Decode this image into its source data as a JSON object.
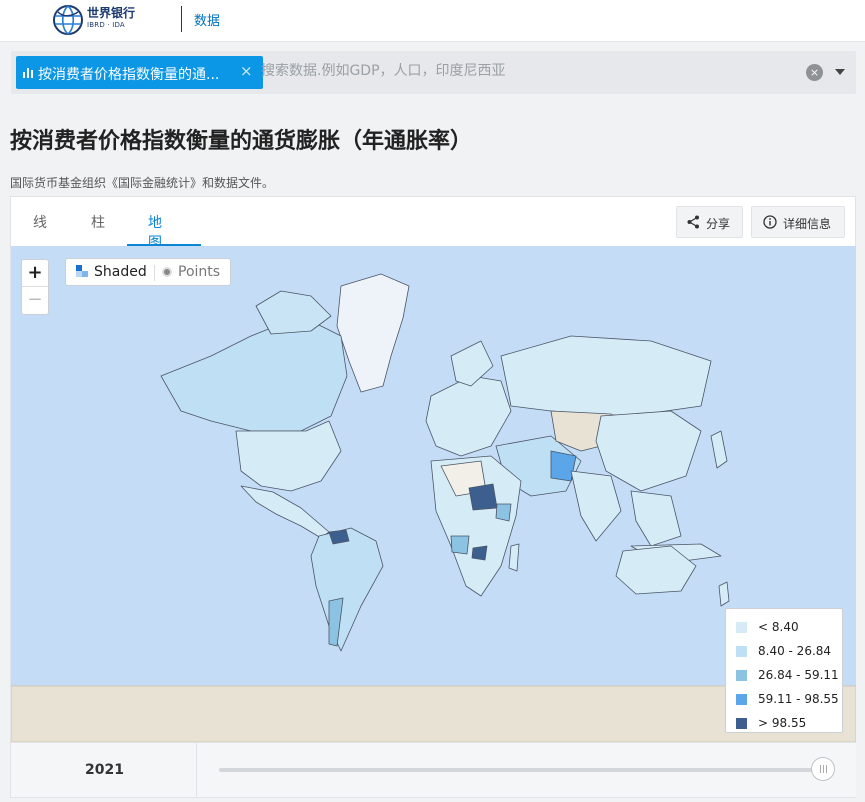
{
  "header": {
    "logo_title": "世界银行",
    "logo_subtitle": "IBRD · IDA",
    "nav_data": "数据"
  },
  "search": {
    "tag_label": "按消费者价格指数衡量的通...",
    "tag_close": "×",
    "placeholder": "搜索数据.例如GDP，人口，印度尼西亚",
    "clear": "×"
  },
  "page": {
    "title": "按消费者价格指数衡量的通货膨胀（年通胀率）",
    "source": "国际货币基金组织《国际金融统计》和数据文件。"
  },
  "tabs": [
    "线",
    "柱",
    "地图"
  ],
  "active_tab": "地图",
  "actions": {
    "share": "分享",
    "details": "详细信息"
  },
  "map": {
    "zoom_in": "+",
    "zoom_out": "−",
    "mode_shaded": "Shaded",
    "mode_points": "Points",
    "active_mode": "Shaded",
    "ocean_color": "#c5dcf7",
    "land_nodata_color": "#e8e2d4",
    "legend": [
      {
        "label": "< 8.40",
        "color": "#d5ecf7"
      },
      {
        "label": "8.40 - 26.84",
        "color": "#bfe0f4"
      },
      {
        "label": "26.84 - 59.11",
        "color": "#8cc3e3"
      },
      {
        "label": "59.11 - 98.55",
        "color": "#5aa6e8"
      },
      {
        "label": "> 98.55",
        "color": "#3d5f8f"
      }
    ]
  },
  "timeline": {
    "year": "2021",
    "position": 1.0
  }
}
